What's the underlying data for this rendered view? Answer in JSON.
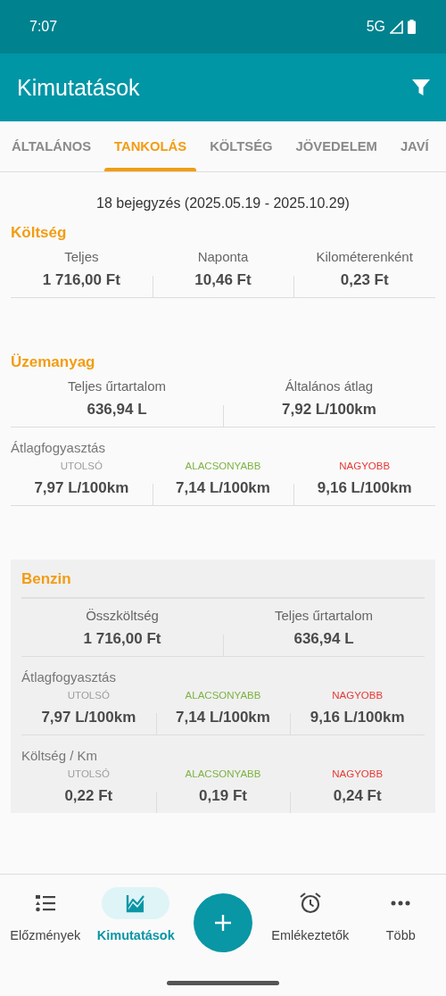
{
  "status_bar": {
    "time": "7:07",
    "network": "5G"
  },
  "app_bar": {
    "title": "Kimutatások"
  },
  "tabs": [
    {
      "label": "ÁLTALÁNOS",
      "selected": false
    },
    {
      "label": "TANKOLÁS",
      "selected": true
    },
    {
      "label": "KÖLTSÉG",
      "selected": false
    },
    {
      "label": "JÖVEDELEM",
      "selected": false
    },
    {
      "label": "JAVÍ",
      "selected": false
    }
  ],
  "summary": "18 bejegyzés (2025.05.19 - 2025.10.29)",
  "sections": [
    {
      "title": "Költség",
      "kind": "plain",
      "groups": [
        {
          "kind": "totals",
          "stats": [
            {
              "label": "Teljes",
              "value": "1 716,00 Ft"
            },
            {
              "label": "Naponta",
              "value": "10,46 Ft"
            },
            {
              "label": "Kilométerenként",
              "value": "0,23 Ft"
            }
          ]
        }
      ]
    },
    {
      "title": "Üzemanyag",
      "kind": "plain",
      "groups": [
        {
          "kind": "totals",
          "stats": [
            {
              "label": "Teljes űrtartalom",
              "value": "636,94 L"
            },
            {
              "label": "Általános átlag",
              "value": "7,92 L/100km"
            }
          ]
        },
        {
          "kind": "range",
          "label": "Átlagfogyasztás",
          "stats": [
            {
              "label": "UTOLSÓ",
              "value": "7,97 L/100km",
              "color": "#9e9e9e"
            },
            {
              "label": "ALACSONYABB",
              "value": "7,14 L/100km",
              "color": "#7cb342"
            },
            {
              "label": "NAGYOBB",
              "value": "9,16 L/100km",
              "color": "#e53935"
            }
          ]
        }
      ]
    },
    {
      "title": "Benzin",
      "kind": "card",
      "groups": [
        {
          "kind": "totals",
          "stats": [
            {
              "label": "Összköltség",
              "value": "1 716,00 Ft"
            },
            {
              "label": "Teljes űrtartalom",
              "value": "636,94 L"
            }
          ]
        },
        {
          "kind": "range",
          "label": "Átlagfogyasztás",
          "stats": [
            {
              "label": "UTOLSÓ",
              "value": "7,97 L/100km",
              "color": "#9e9e9e"
            },
            {
              "label": "ALACSONYABB",
              "value": "7,14 L/100km",
              "color": "#7cb342"
            },
            {
              "label": "NAGYOBB",
              "value": "9,16 L/100km",
              "color": "#e53935"
            }
          ]
        },
        {
          "kind": "range",
          "label": "Költség / Km",
          "stats": [
            {
              "label": "UTOLSÓ",
              "value": "0,22 Ft",
              "color": "#9e9e9e"
            },
            {
              "label": "ALACSONYABB",
              "value": "0,19 Ft",
              "color": "#7cb342"
            },
            {
              "label": "NAGYOBB",
              "value": "0,24 Ft",
              "color": "#e53935"
            }
          ]
        }
      ]
    }
  ],
  "bottom_nav": [
    {
      "label": "Előzmények",
      "selected": false
    },
    {
      "label": "Kimutatások",
      "selected": true
    },
    {
      "label": "Emlékeztetők",
      "selected": false
    },
    {
      "label": "Több",
      "selected": false
    }
  ]
}
